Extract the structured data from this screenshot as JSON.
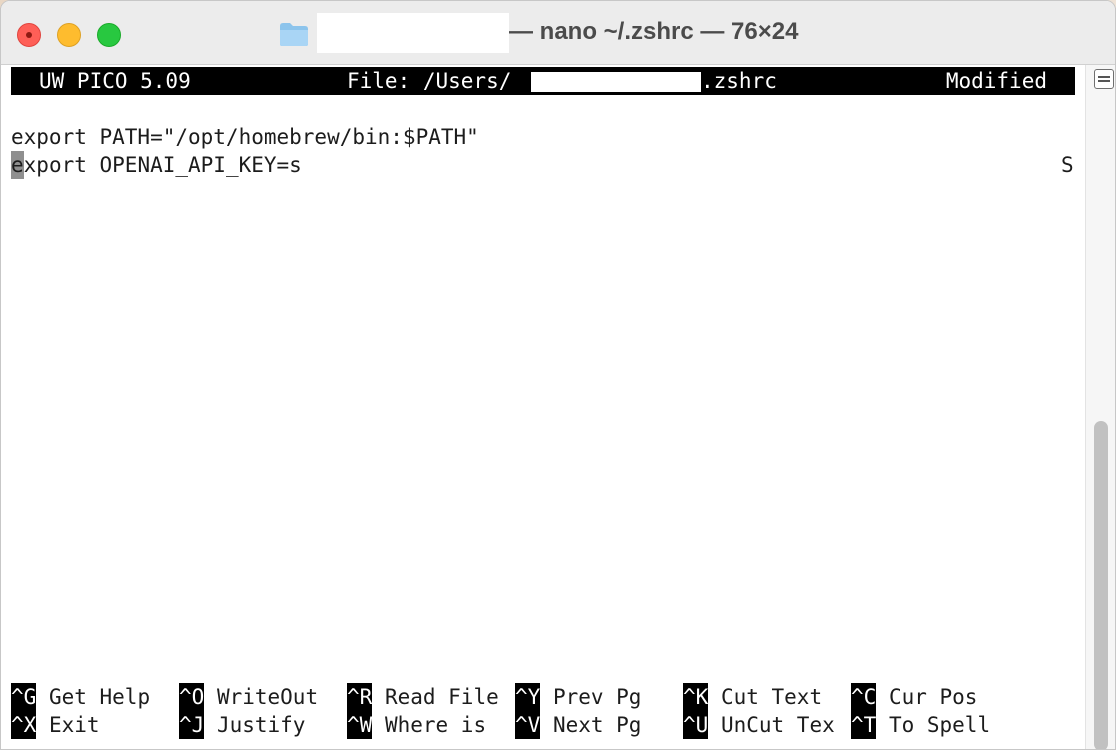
{
  "window": {
    "title": "— nano ~/.zshrc — 76×24"
  },
  "editor": {
    "app_name": "UW PICO 5.09",
    "file_prefix": "File: /Users/",
    "file_suffix": ".zshrc",
    "status": "Modified",
    "lines": [
      "export PATH=\"/opt/homebrew/bin:$PATH\"",
      "xport OPENAI_API_KEY=s"
    ],
    "cursor_char": "e",
    "edge_char": "S"
  },
  "shortcuts": [
    {
      "key": "^G",
      "label": " Get Help"
    },
    {
      "key": "^O",
      "label": " WriteOut"
    },
    {
      "key": "^R",
      "label": " Read File"
    },
    {
      "key": "^Y",
      "label": " Prev Pg"
    },
    {
      "key": "^K",
      "label": " Cut Text"
    },
    {
      "key": "^C",
      "label": " Cur Pos"
    },
    {
      "key": "^X",
      "label": " Exit"
    },
    {
      "key": "^J",
      "label": " Justify"
    },
    {
      "key": "^W",
      "label": " Where is"
    },
    {
      "key": "^V",
      "label": " Next Pg"
    },
    {
      "key": "^U",
      "label": " UnCut Tex"
    },
    {
      "key": "^T",
      "label": " To Spell"
    }
  ],
  "icons": {
    "folder": "folder-icon",
    "close": "close-icon",
    "minimize": "minimize-icon",
    "maximize": "maximize-icon",
    "scroll_toggle": "scroll-toggle-icon"
  }
}
